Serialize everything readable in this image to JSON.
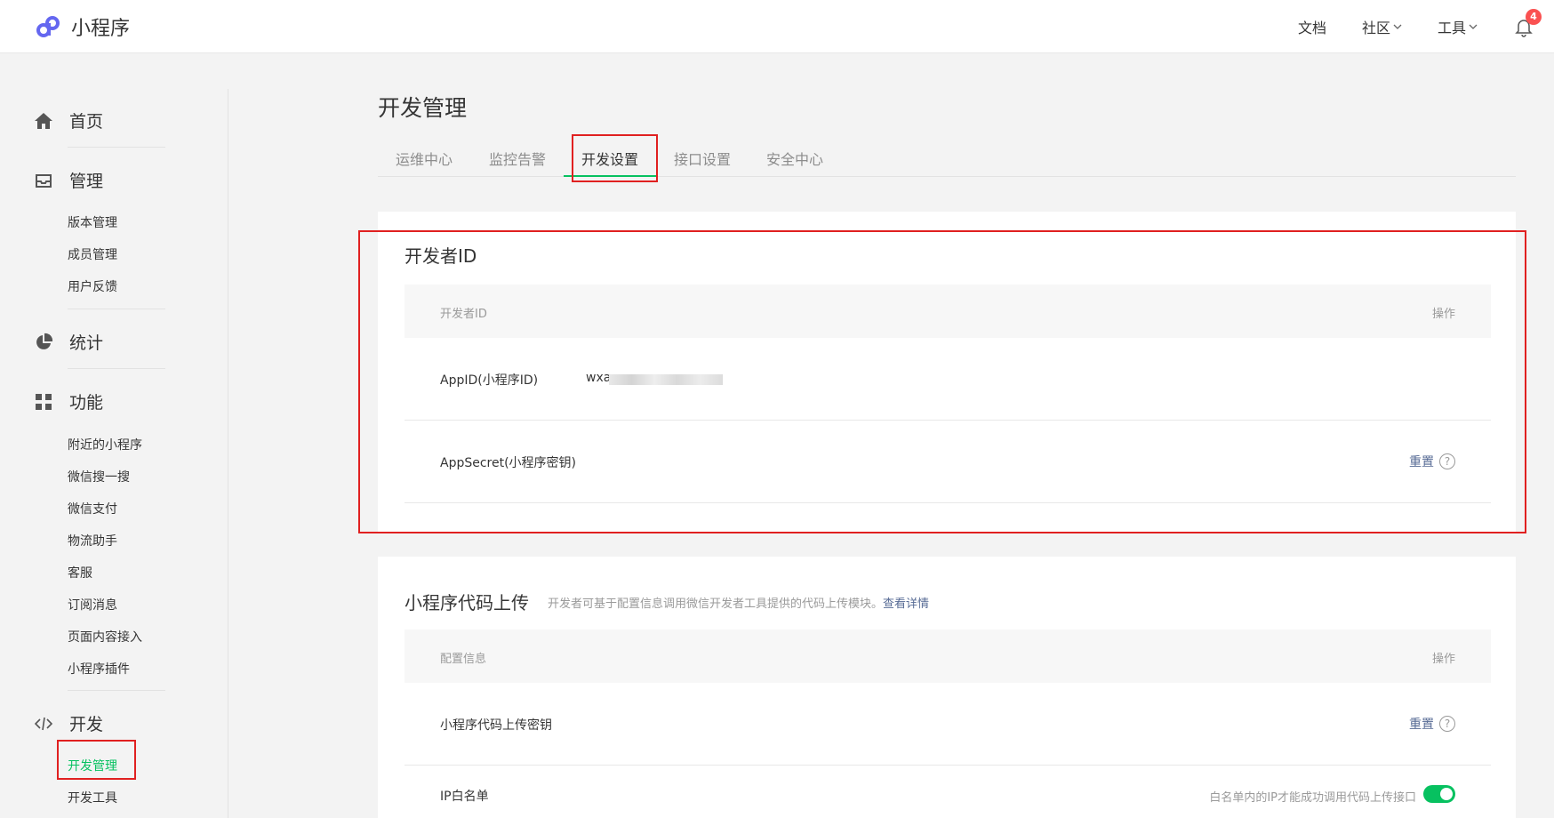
{
  "header": {
    "app_name": "小程序",
    "nav": [
      {
        "label": "文档",
        "dropdown": false
      },
      {
        "label": "社区",
        "dropdown": true
      },
      {
        "label": "工具",
        "dropdown": true
      }
    ],
    "notification_count": "4",
    "brand_color": "#07c160"
  },
  "sidebar": {
    "home": "首页",
    "manage": "管理",
    "manage_items": [
      "版本管理",
      "成员管理",
      "用户反馈"
    ],
    "stats": "统计",
    "features": "功能",
    "feature_items": [
      "附近的小程序",
      "微信搜一搜",
      "微信支付",
      "物流助手",
      "客服",
      "订阅消息",
      "页面内容接入",
      "小程序插件"
    ],
    "dev": "开发",
    "dev_items": [
      "开发管理",
      "开发工具"
    ],
    "active_item": "开发管理"
  },
  "main": {
    "title": "开发管理",
    "tabs": [
      "运维中心",
      "监控告警",
      "开发设置",
      "接口设置",
      "安全中心"
    ],
    "active_tab": "开发设置",
    "dev_id": {
      "title": "开发者ID",
      "col_name": "开发者ID",
      "col_action": "操作",
      "appid_label": "AppID(小程序ID)",
      "appid_value": "wxa",
      "secret_label": "AppSecret(小程序密钥)",
      "secret_action": "重置"
    },
    "upload": {
      "title": "小程序代码上传",
      "desc": "开发者可基于配置信息调用微信开发者工具提供的代码上传模块。",
      "desc_link": "查看详情",
      "col_name": "配置信息",
      "col_action": "操作",
      "key_label": "小程序代码上传密钥",
      "key_action": "重置",
      "ip_label": "IP白名单",
      "ip_hint": "白名单内的IP才能成功调用代码上传接口",
      "ip_enabled": true
    }
  }
}
